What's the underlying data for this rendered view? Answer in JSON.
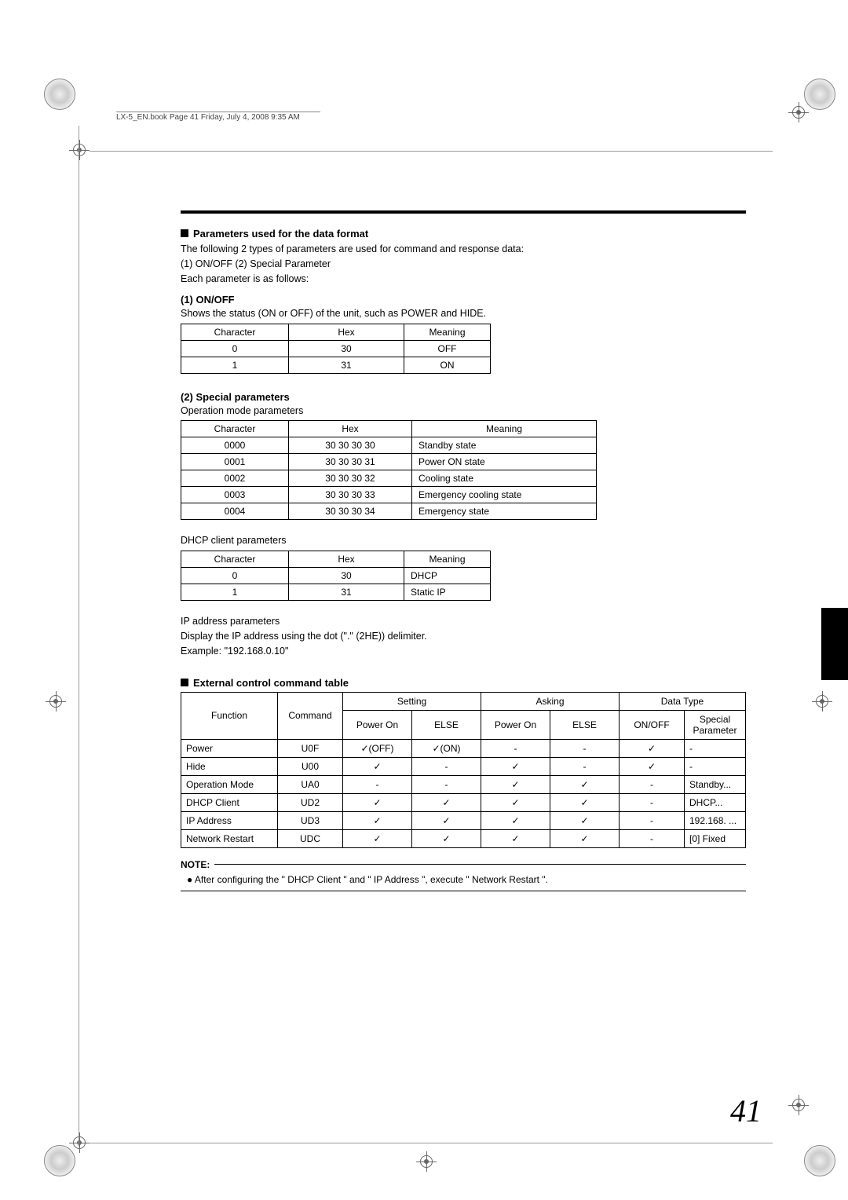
{
  "header": {
    "book_info": "LX-5_EN.book  Page 41  Friday, July 4, 2008  9:35 AM"
  },
  "section1": {
    "title": "Parameters used for the data format",
    "intro1": "The following 2 types of parameters are used for command and response data:",
    "intro2": "(1) ON/OFF (2) Special Parameter",
    "intro3": "Each parameter is as follows:"
  },
  "onoff": {
    "title": "(1) ON/OFF",
    "desc": "Shows the status (ON or OFF) of the unit, such as POWER and HIDE.",
    "headers": [
      "Character",
      "Hex",
      "Meaning"
    ],
    "rows": [
      [
        "0",
        "30",
        "OFF"
      ],
      [
        "1",
        "31",
        "ON"
      ]
    ]
  },
  "special": {
    "title": "(2) Special parameters",
    "subtitle": "Operation mode parameters",
    "headers": [
      "Character",
      "Hex",
      "Meaning"
    ],
    "rows": [
      [
        "0000",
        "30 30 30 30",
        "Standby state"
      ],
      [
        "0001",
        "30 30 30 31",
        "Power ON state"
      ],
      [
        "0002",
        "30 30 30 32",
        "Cooling state"
      ],
      [
        "0003",
        "30 30 30 33",
        "Emergency cooling state"
      ],
      [
        "0004",
        "30 30 30 34",
        "Emergency state"
      ]
    ],
    "dhcp_title": "DHCP client parameters",
    "dhcp_headers": [
      "Character",
      "Hex",
      "Meaning"
    ],
    "dhcp_rows": [
      [
        "0",
        "30",
        "DHCP"
      ],
      [
        "1",
        "31",
        "Static IP"
      ]
    ],
    "ip_title": "IP address parameters",
    "ip_line1": "Display the IP address using the dot (\".\" (2HE)) delimiter.",
    "ip_line2": "Example: \"192.168.0.10\""
  },
  "cmd": {
    "title": "External control command table",
    "group_headers": [
      "Function",
      "Command",
      "Setting",
      "Asking",
      "Data Type"
    ],
    "sub_headers": [
      "Power On",
      "ELSE",
      "Power On",
      "ELSE",
      "ON/OFF",
      "Special Parameter"
    ],
    "rows": [
      {
        "func": "Power",
        "cmd": "U0F",
        "s_on": "✓(OFF)",
        "s_else": "✓(ON)",
        "a_on": "-",
        "a_else": "-",
        "onoff": "✓",
        "sp": "-"
      },
      {
        "func": "Hide",
        "cmd": "U00",
        "s_on": "✓",
        "s_else": "-",
        "a_on": "✓",
        "a_else": "-",
        "onoff": "✓",
        "sp": "-"
      },
      {
        "func": "Operation Mode",
        "cmd": "UA0",
        "s_on": "-",
        "s_else": "-",
        "a_on": "✓",
        "a_else": "✓",
        "onoff": "-",
        "sp": "Standby..."
      },
      {
        "func": "DHCP Client",
        "cmd": "UD2",
        "s_on": "✓",
        "s_else": "✓",
        "a_on": "✓",
        "a_else": "✓",
        "onoff": "-",
        "sp": "DHCP..."
      },
      {
        "func": "IP Address",
        "cmd": "UD3",
        "s_on": "✓",
        "s_else": "✓",
        "a_on": "✓",
        "a_else": "✓",
        "onoff": "-",
        "sp": "192.168. ..."
      },
      {
        "func": "Network Restart",
        "cmd": "UDC",
        "s_on": "✓",
        "s_else": "✓",
        "a_on": "✓",
        "a_else": "✓",
        "onoff": "-",
        "sp": "[0] Fixed"
      }
    ]
  },
  "note": {
    "label": "NOTE:",
    "body": "● After configuring the \" DHCP Client \" and \" IP Address \", execute \" Network Restart \"."
  },
  "page_number": "41"
}
